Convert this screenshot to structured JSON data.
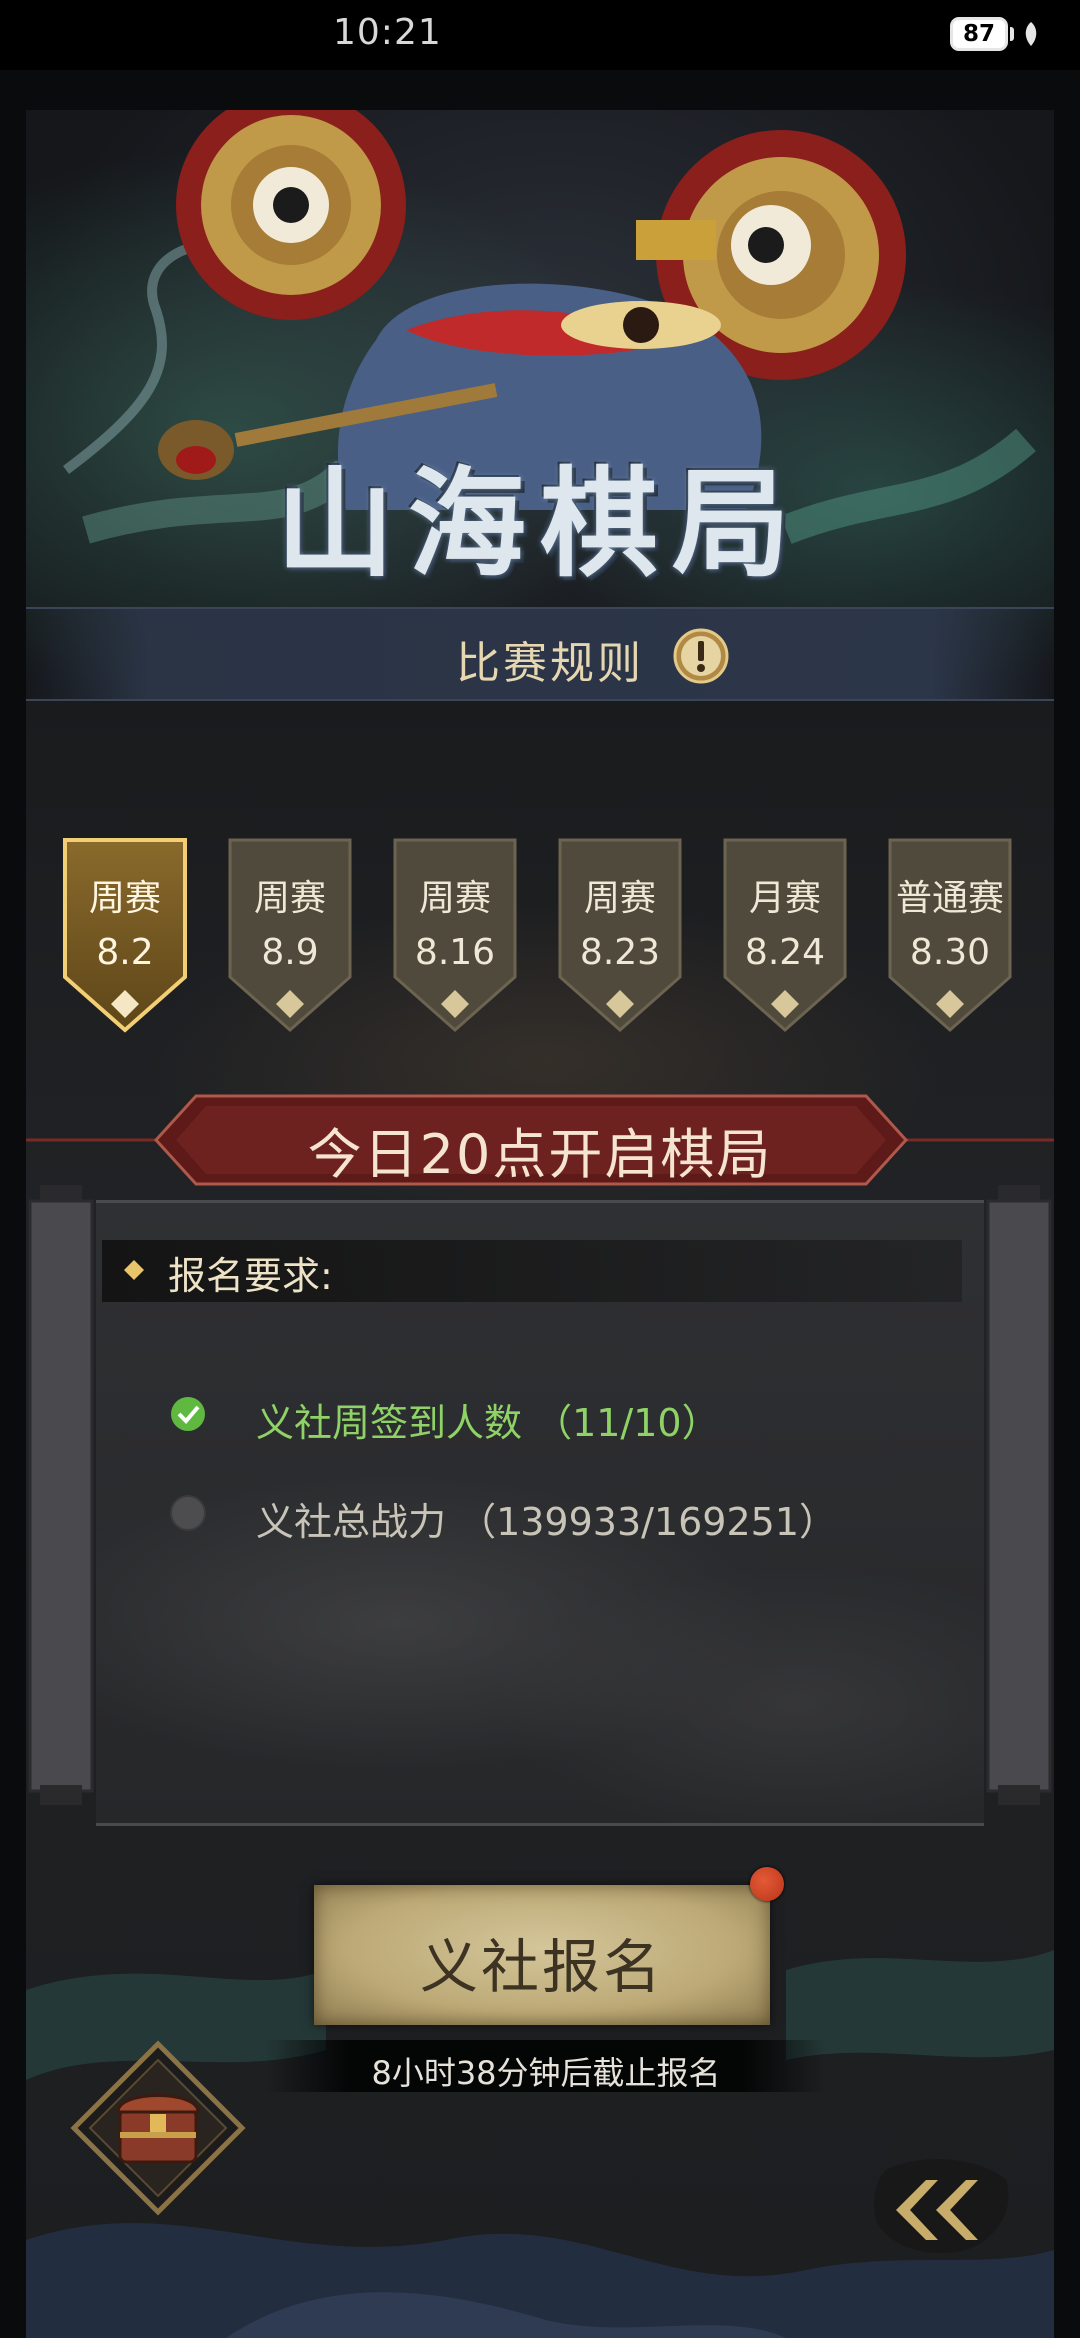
{
  "status_bar": {
    "time": "10:21",
    "battery": "87"
  },
  "game": {
    "title": "山海棋局",
    "rules_label": "比赛规则",
    "tabs": [
      {
        "label": "周赛",
        "value": "8.2",
        "active": true
      },
      {
        "label": "周赛",
        "value": "8.9",
        "active": false
      },
      {
        "label": "周赛",
        "value": "8.16",
        "active": false
      },
      {
        "label": "周赛",
        "value": "8.23",
        "active": false
      },
      {
        "label": "月赛",
        "value": "8.24",
        "active": false
      },
      {
        "label": "普通赛",
        "value": "8.30",
        "active": false
      }
    ],
    "open_banner": "今日20点开启棋局",
    "requirements": {
      "title": "报名要求:",
      "items": [
        {
          "text": "义社周签到人数 （11/10）",
          "met": true
        },
        {
          "text": "义社总战力 （139933/169251）",
          "met": false
        }
      ]
    },
    "signup_button": "义社报名",
    "deadline": "8小时38分钟后截止报名",
    "colors": {
      "met": "#8fd266",
      "unmet": "#c9c4b8",
      "gold": "#b89a5c"
    }
  }
}
